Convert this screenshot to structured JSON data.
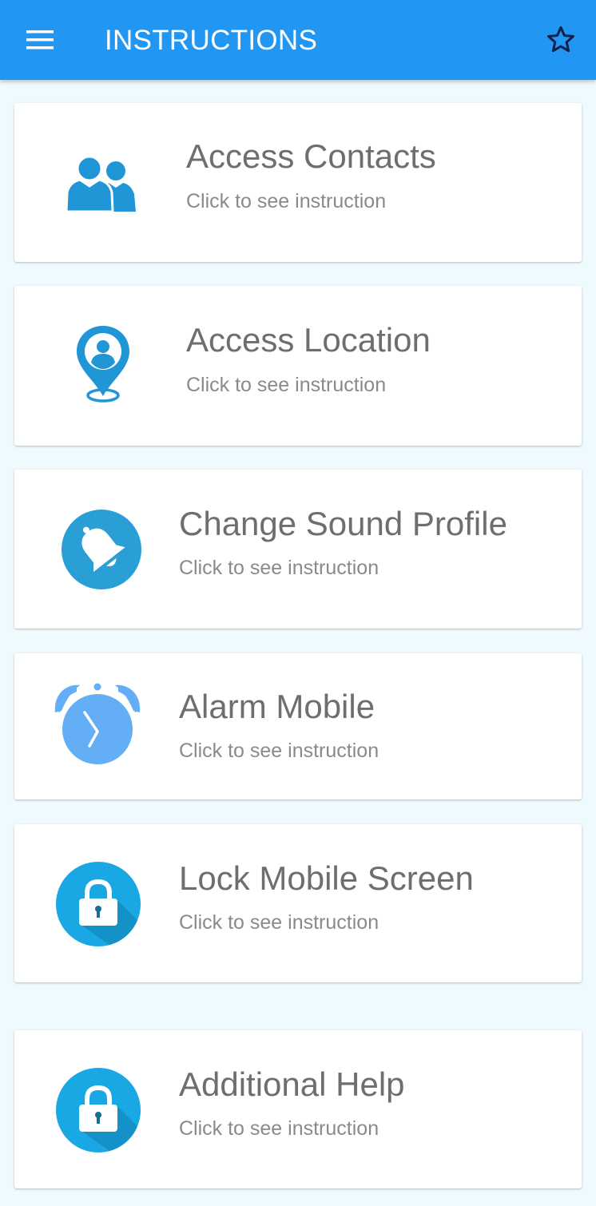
{
  "app_bar": {
    "title": "INSTRUCTIONS",
    "background_color": "#2196f3",
    "menu_icon": "hamburger-menu-icon",
    "star_icon": "star-outline-icon"
  },
  "items": [
    {
      "title": "Access Contacts",
      "subtitle": "Click to see instruction",
      "icon": "contacts-icon"
    },
    {
      "title": "Access Location",
      "subtitle": "Click to see instruction",
      "icon": "location-pin-icon"
    },
    {
      "title": "Change Sound Profile",
      "subtitle": "Click to see instruction",
      "icon": "bell-icon"
    },
    {
      "title": "Alarm Mobile",
      "subtitle": "Click to see instruction",
      "icon": "alarm-clock-icon"
    },
    {
      "title": "Lock Mobile Screen",
      "subtitle": "Click to see instruction",
      "icon": "lock-icon"
    },
    {
      "title": "Additional Help",
      "subtitle": "Click to see instruction",
      "icon": "lock-icon"
    }
  ],
  "colors": {
    "icon_blue": "#2196d6",
    "icon_light_blue": "#64aef5",
    "lock_blue": "#19a8e3",
    "page_background": "#eefafd"
  }
}
